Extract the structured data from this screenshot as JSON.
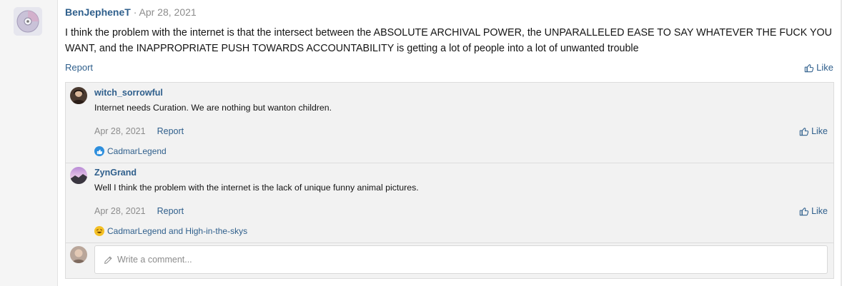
{
  "post": {
    "author": "BenJepheneT",
    "separator": "·",
    "date": "Apr 28, 2021",
    "body": "I think the problem with the internet is that the intersect between the ABSOLUTE ARCHIVAL POWER, the UNPARALLELED EASE TO SAY WHATEVER THE FUCK YOU WANT, and the INAPPROPRIATE PUSH TOWARDS ACCOUNTABILITY is getting a lot of people into a lot of unwanted trouble",
    "report_label": "Report",
    "like_label": "Like"
  },
  "comments": [
    {
      "author": "witch_sorrowful",
      "text": "Internet needs Curation. We are nothing but wanton children.",
      "date": "Apr 28, 2021",
      "report_label": "Report",
      "like_label": "Like",
      "reactions": "CadmarLegend",
      "reaction_icon": "thumbs-up-icon"
    },
    {
      "author": "ZynGrand",
      "text": "Well I think the problem with the internet is the lack of unique funny animal pictures.",
      "date": "Apr 28, 2021",
      "report_label": "Report",
      "like_label": "Like",
      "reactions": "CadmarLegend and High-in-the-skys",
      "reaction_icon": "laughing-face-icon"
    }
  ],
  "composer": {
    "placeholder": "Write a comment..."
  },
  "colors": {
    "link": "#2f5f8c",
    "muted": "#8c8c8c",
    "comments_bg": "#f2f2f2",
    "reaction_like": "#2e8fdd",
    "reaction_laugh": "#f4c025"
  }
}
